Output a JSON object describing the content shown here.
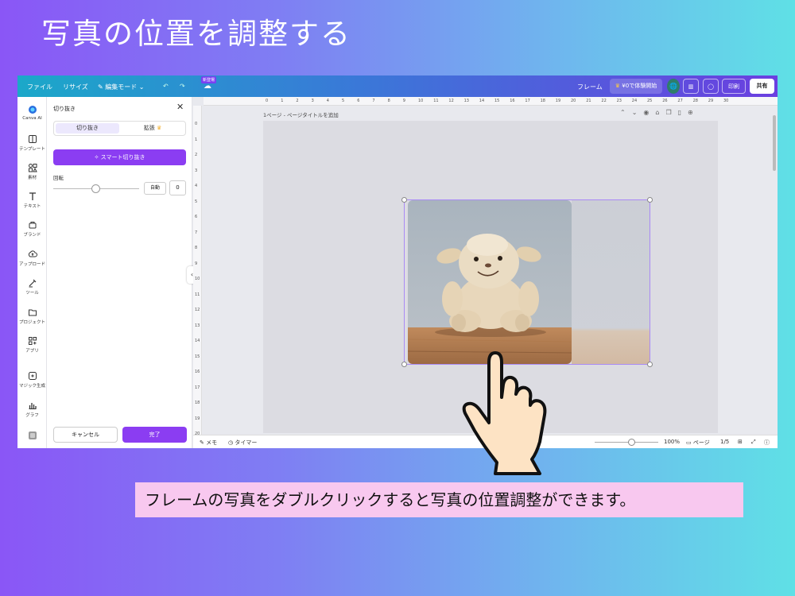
{
  "slide": {
    "title": "写真の位置を調整する",
    "caption": "フレームの写真をダブルクリックすると写真の位置調整ができます。"
  },
  "topbar": {
    "file": "ファイル",
    "resize": "リサイズ",
    "edit_mode": "編集モード",
    "new_badge": "新登場",
    "frame": "フレーム",
    "trial": "¥0で体験開始",
    "print": "印刷",
    "share": "共有"
  },
  "rail": {
    "items": [
      {
        "label": "Canva AI",
        "icon": "canva-ai-icon"
      },
      {
        "label": "テンプレート",
        "icon": "template-icon"
      },
      {
        "label": "素材",
        "icon": "elements-icon"
      },
      {
        "label": "テキスト",
        "icon": "text-icon"
      },
      {
        "label": "ブランド",
        "icon": "brand-icon"
      },
      {
        "label": "アップロード",
        "icon": "upload-icon"
      },
      {
        "label": "ツール",
        "icon": "tools-icon"
      },
      {
        "label": "プロジェクト",
        "icon": "folder-icon"
      },
      {
        "label": "アプリ",
        "icon": "apps-icon"
      },
      {
        "label": "マジック生成",
        "icon": "magic-icon"
      },
      {
        "label": "グラフ",
        "icon": "chart-icon"
      }
    ]
  },
  "panel": {
    "title": "切り抜き",
    "tab_crop": "切り抜き",
    "tab_expand": "拡張",
    "smart_crop": "スマート切り抜き",
    "rotation_label": "回転",
    "auto": "自動",
    "rotation_value": "0",
    "cancel": "キャンセル",
    "done": "完了"
  },
  "canvas": {
    "page_label": "1ページ - ページタイトルを追加",
    "ruler_top": [
      "0",
      "1",
      "2",
      "3",
      "4",
      "5",
      "6",
      "7",
      "8",
      "9",
      "10",
      "11",
      "12",
      "13",
      "14",
      "15",
      "16",
      "17",
      "18",
      "19",
      "20",
      "21",
      "22",
      "23",
      "24",
      "25",
      "26",
      "27",
      "28",
      "29",
      "30"
    ],
    "ruler_left": [
      "0",
      "1",
      "2",
      "3",
      "4",
      "5",
      "6",
      "7",
      "8",
      "9",
      "10",
      "11",
      "12",
      "13",
      "14",
      "15",
      "16",
      "17",
      "18",
      "19",
      "20"
    ]
  },
  "bottombar": {
    "memo": "メモ",
    "timer": "タイマー",
    "zoom": "100%",
    "pages": "ページ",
    "page_count": "1/5"
  },
  "colors": {
    "accent": "#8b3df2",
    "caption_bg": "#f8c8ef"
  }
}
